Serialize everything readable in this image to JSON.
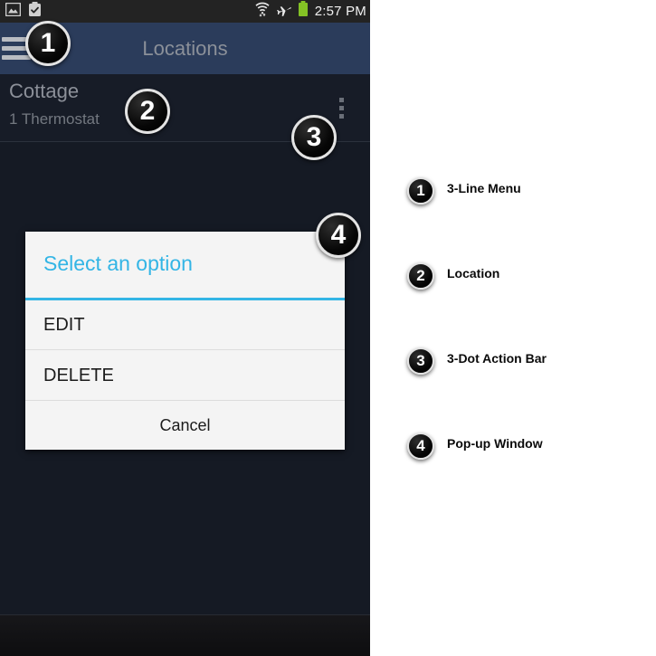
{
  "phone": {
    "status_bar": {
      "left_icons": [
        "gallery-image-icon",
        "clipboard-check-icon"
      ],
      "right_icons": [
        "wifi-transfer-icon",
        "airplane-mode-icon",
        "battery-full-icon"
      ],
      "clock": "2:57 PM"
    },
    "action_bar": {
      "menu_icon": "hamburger-menu-icon",
      "title": "Locations",
      "background_color": "#2b3c5b"
    },
    "list": {
      "rows": [
        {
          "title": "Cottage",
          "subtitle": "1 Thermostat",
          "overflow_icon": "three-dot-overflow-icon"
        }
      ]
    },
    "dialog": {
      "title": "Select an option",
      "accent_color": "#33b5e5",
      "items": [
        "EDIT",
        "DELETE"
      ],
      "cancel": "Cancel"
    }
  },
  "callouts": [
    {
      "number": "1"
    },
    {
      "number": "2"
    },
    {
      "number": "3"
    },
    {
      "number": "4"
    }
  ],
  "legend": {
    "items": [
      {
        "number": "1",
        "label": "3-Line Menu"
      },
      {
        "number": "2",
        "label": "Location"
      },
      {
        "number": "3",
        "label": "3-Dot Action Bar"
      },
      {
        "number": "4",
        "label": "Pop-up Window"
      }
    ]
  }
}
